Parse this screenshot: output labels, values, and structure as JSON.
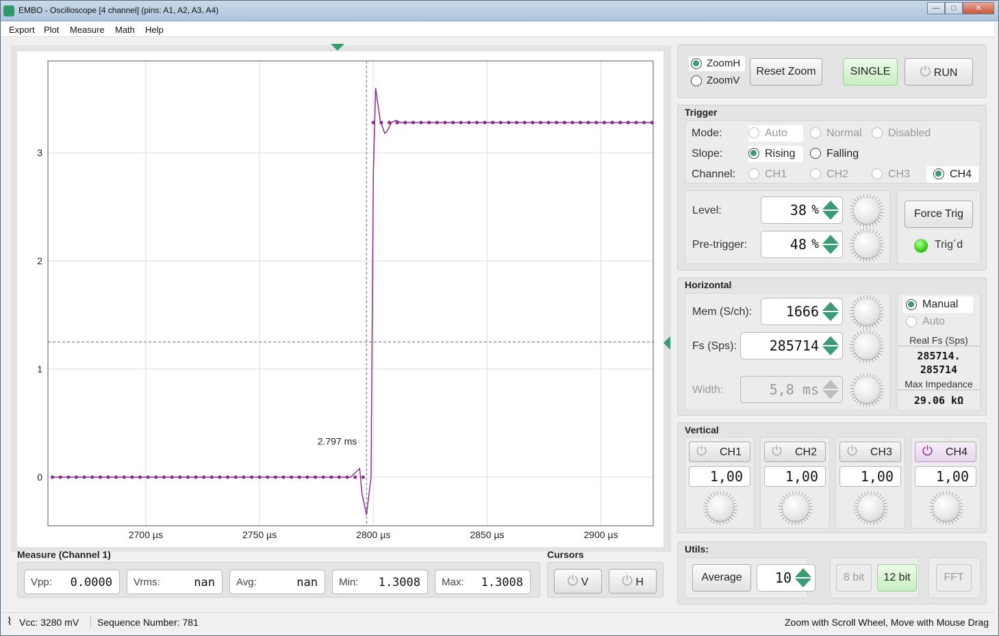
{
  "window": {
    "title": "EMBO - Oscilloscope [4 channel] (pins: A1, A2, A3, A4)",
    "minimize_icon": "minimize-icon",
    "maximize_icon": "maximize-icon",
    "close_icon": "close-icon"
  },
  "menu": [
    "Export",
    "Plot",
    "Measure",
    "Math",
    "Help"
  ],
  "plot": {
    "x_ticks": [
      "2700 µs",
      "2750 µs",
      "2800 µs",
      "2850 µs",
      "2900 µs"
    ],
    "y_ticks": [
      "0",
      "1",
      "2",
      "3"
    ],
    "cursor_label": "2.797 ms",
    "trace_color": "#8b2f8b",
    "grid_color": "#dddddd",
    "trigger_marker_color": "#3a9c72"
  },
  "chart_data": {
    "type": "line",
    "x_unit": "µs",
    "xlim": [
      2657,
      2923
    ],
    "ylim": [
      -0.45,
      3.85
    ],
    "trigger_time_us": 2797,
    "trigger_level": 1.25,
    "series": [
      {
        "color": "#8b2f8b",
        "pre_level": 0.0,
        "post_level": 3.28,
        "x": [
          2659,
          2790,
          2792,
          2794,
          2795,
          2797,
          2799,
          2800,
          2801,
          2802,
          2803,
          2805,
          2806,
          2808,
          2810,
          2812,
          2923
        ],
        "y": [
          0.0,
          0.0,
          0.04,
          0.08,
          -0.15,
          -0.35,
          0.0,
          2.8,
          3.6,
          3.45,
          3.3,
          3.18,
          3.2,
          3.28,
          3.3,
          3.28,
          3.28
        ]
      }
    ]
  },
  "measure": {
    "title": "Measure (Channel 1)",
    "fields": [
      {
        "label": "Vpp:",
        "value": "0.0000"
      },
      {
        "label": "Vrms:",
        "value": "nan"
      },
      {
        "label": "Avg:",
        "value": "nan"
      },
      {
        "label": "Min:",
        "value": "1.3008"
      },
      {
        "label": "Max:",
        "value": "1.3008"
      }
    ]
  },
  "cursors": {
    "title": "Cursors",
    "v_label": "V",
    "h_label": "H"
  },
  "top_controls": {
    "zoomh": "ZoomH",
    "zoomv": "ZoomV",
    "reset_zoom": "Reset Zoom",
    "single": "SINGLE",
    "run": "RUN"
  },
  "trigger": {
    "title": "Trigger",
    "mode_label": "Mode:",
    "mode_auto": "Auto",
    "mode_normal": "Normal",
    "mode_disabled": "Disabled",
    "slope_label": "Slope:",
    "slope_rising": "Rising",
    "slope_falling": "Falling",
    "channel_label": "Channel:",
    "ch1": "CH1",
    "ch2": "CH2",
    "ch3": "CH3",
    "ch4": "CH4",
    "level_label": "Level:",
    "level_value": "38",
    "level_unit": "%",
    "pretrig_label": "Pre-trigger:",
    "pretrig_value": "48",
    "pretrig_unit": "%",
    "force_trig": "Force Trig",
    "trigd": "Trig´d"
  },
  "horizontal": {
    "title": "Horizontal",
    "mem_label": "Mem (S/ch):",
    "mem_value": "1666",
    "fs_label": "Fs (Sps):",
    "fs_value": "285714",
    "width_label": "Width:",
    "width_value": "5,8 ms",
    "manual": "Manual",
    "auto": "Auto",
    "real_fs_label": "Real Fs (Sps)",
    "real_fs_value1": "285714.",
    "real_fs_value2": "285714",
    "max_imp_label": "Max Impedance",
    "max_imp_value": "29.06 kΩ"
  },
  "vertical": {
    "title": "Vertical",
    "channels": [
      {
        "name": "CH1",
        "value": "1,00"
      },
      {
        "name": "CH2",
        "value": "1,00"
      },
      {
        "name": "CH3",
        "value": "1,00"
      },
      {
        "name": "CH4",
        "value": "1,00"
      }
    ]
  },
  "utils": {
    "title": "Utils:",
    "average": "Average",
    "avg_value": "10",
    "bit8": "8 bit",
    "bit12": "12 bit",
    "fft": "FFT"
  },
  "status": {
    "vcc": "Vcc: 3280 mV",
    "sequence": "Sequence Number: 781",
    "hint": "Zoom with Scroll Wheel, Move with Mouse Drag"
  }
}
